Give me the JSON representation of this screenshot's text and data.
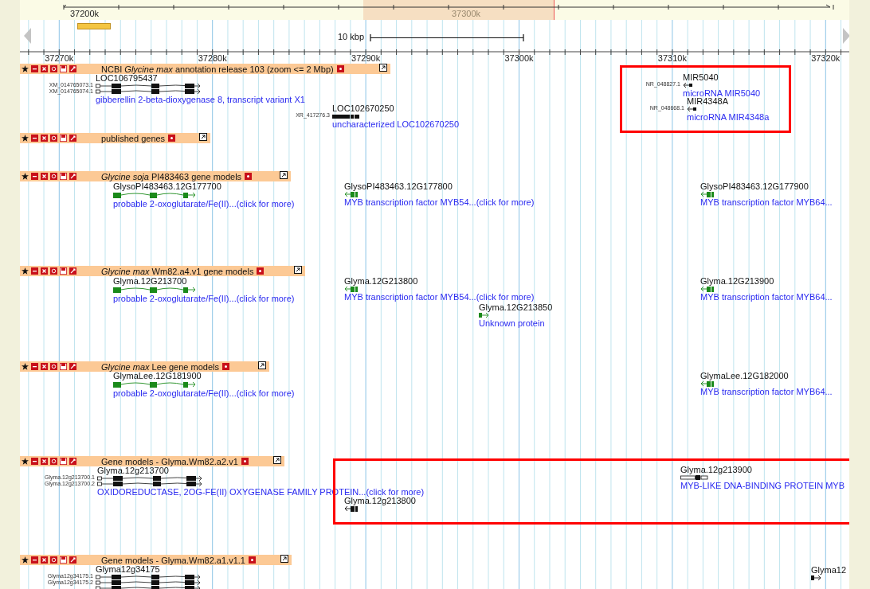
{
  "overview": {
    "labels": [
      "37200k",
      "37300k"
    ]
  },
  "scale_bar": {
    "label": "10 kbp"
  },
  "ruler": {
    "labels": [
      "37270k",
      "37280k",
      "37290k",
      "37300k",
      "37310k",
      "37320k"
    ]
  },
  "tracks": [
    {
      "title": "NCBI *Glycine max* annotation release 103 (zoom <= 2 Mbp)",
      "features": [
        {
          "name": "LOC106795437",
          "transcripts": [
            "XM_014765073.1",
            "XM_014765074.1"
          ],
          "description": "gibberellin 2-beta-dioxygenase 8, transcript variant X1"
        },
        {
          "name": "LOC102670250",
          "transcripts": [
            "XR_417276.3"
          ],
          "description": "uncharacterized LOC102670250"
        },
        {
          "name": "MIR5040",
          "transcripts": [
            "NR_048827.1"
          ],
          "description": "microRNA MIR5040"
        },
        {
          "name": "MIR4348A",
          "transcripts": [
            "NR_048668.1"
          ],
          "description": "microRNA MIR4348a"
        }
      ]
    },
    {
      "title": "published genes"
    },
    {
      "title": "*Glycine soja* PI483463 gene models",
      "features": [
        {
          "name": "GlysoPI483463.12G177700",
          "description": "probable 2-oxoglutarate/Fe(II)...(click for more)"
        },
        {
          "name": "GlysoPI483463.12G177800",
          "description": "MYB transcription factor MYB54...(click for more)"
        },
        {
          "name": "GlysoPI483463.12G177900",
          "description": "MYB transcription factor MYB64..."
        }
      ]
    },
    {
      "title": "*Glycine max* Wm82.a4.v1 gene models",
      "features": [
        {
          "name": "Glyma.12G213700",
          "description": "probable 2-oxoglutarate/Fe(II)...(click for more)"
        },
        {
          "name": "Glyma.12G213800",
          "description": "MYB transcription factor MYB54...(click for more)"
        },
        {
          "name": "Glyma.12G213850",
          "description": "Unknown protein"
        },
        {
          "name": "Glyma.12G213900",
          "description": "MYB transcription factor MYB64..."
        }
      ]
    },
    {
      "title": "*Glycine max* Lee gene models",
      "features": [
        {
          "name": "GlymaLee.12G181900",
          "description": "probable 2-oxoglutarate/Fe(II)...(click for more)"
        },
        {
          "name": "GlymaLee.12G182000",
          "description": "MYB transcription factor MYB64..."
        }
      ]
    },
    {
      "title": "Gene models - Glyma.Wm82.a2.v1",
      "features": [
        {
          "name": "Glyma.12g213700",
          "transcripts": [
            "Glyma.12g213700.1",
            "Glyma.12g213700.2"
          ],
          "description": "OXIDOREDUCTASE, 2OG-FE(II) OXYGENASE FAMILY PROTEIN...(click for more)"
        },
        {
          "name": "Glyma.12g213800"
        },
        {
          "name": "Glyma.12g213900",
          "description": "MYB-LIKE DNA-BINDING PROTEIN MYB"
        }
      ]
    },
    {
      "title": "Gene models - Glyma.Wm82.a1.v1.1",
      "features": [
        {
          "name": "Glyma12g34175",
          "transcripts": [
            "Glyma12g34175.1",
            "Glyma12g34175.2"
          ]
        },
        {
          "name": "Glyma12"
        }
      ]
    }
  ]
}
